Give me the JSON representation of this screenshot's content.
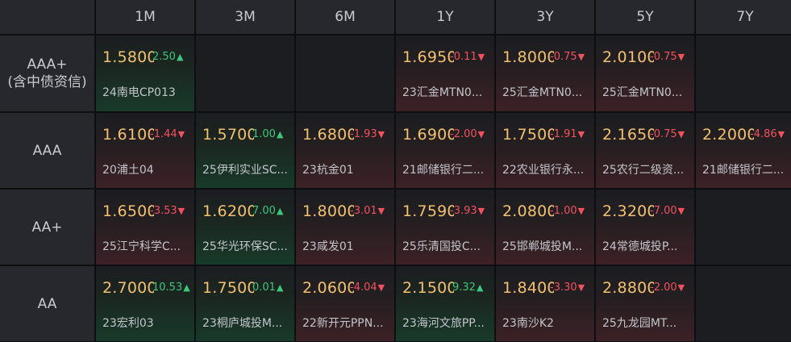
{
  "colors": {
    "up": "#3ec77a",
    "down": "#f2525e",
    "value": "#f2c170"
  },
  "icons": {
    "up": "triangle-up-icon",
    "down": "triangle-down-icon"
  },
  "header": {
    "tenors": [
      "1M",
      "3M",
      "6M",
      "1Y",
      "3Y",
      "5Y",
      "7Y"
    ]
  },
  "rows": [
    {
      "label_lines": [
        "AAA+",
        "(含中债资信)"
      ],
      "cells": [
        {
          "value": "1.5800",
          "change": "2.50",
          "dir": "up",
          "name": "24南电CP013"
        },
        null,
        null,
        {
          "value": "1.6950",
          "change": "-0.11",
          "dir": "down",
          "name": "23汇金MTN0..."
        },
        {
          "value": "1.8000",
          "change": "-0.75",
          "dir": "down",
          "name": "25汇金MTN0..."
        },
        {
          "value": "2.0100",
          "change": "-0.75",
          "dir": "down",
          "name": "25汇金MTN0..."
        },
        null
      ]
    },
    {
      "label_lines": [
        "AAA"
      ],
      "cells": [
        {
          "value": "1.6100",
          "change": "-1.44",
          "dir": "down",
          "name": "20浦土04"
        },
        {
          "value": "1.5700",
          "change": "1.00",
          "dir": "up",
          "name": "25伊利实业SC..."
        },
        {
          "value": "1.6800",
          "change": "-1.93",
          "dir": "down",
          "name": "23杭金01"
        },
        {
          "value": "1.6900",
          "change": "-2.00",
          "dir": "down",
          "name": "21邮储银行二..."
        },
        {
          "value": "1.7500",
          "change": "-1.91",
          "dir": "down",
          "name": "22农业银行永..."
        },
        {
          "value": "2.1650",
          "change": "-0.75",
          "dir": "down",
          "name": "25农行二级资..."
        },
        {
          "value": "2.2000",
          "change": "-4.86",
          "dir": "down",
          "name": "21邮储银行二..."
        }
      ]
    },
    {
      "label_lines": [
        "AA+"
      ],
      "cells": [
        {
          "value": "1.6500",
          "change": "-3.53",
          "dir": "down",
          "name": "25江宁科学C..."
        },
        {
          "value": "1.6200",
          "change": "7.00",
          "dir": "up",
          "name": "25华光环保SC..."
        },
        {
          "value": "1.8000",
          "change": "-3.01",
          "dir": "down",
          "name": "23咸发01"
        },
        {
          "value": "1.7590",
          "change": "-3.93",
          "dir": "down",
          "name": "25乐清国投C..."
        },
        {
          "value": "2.0800",
          "change": "-1.00",
          "dir": "down",
          "name": "25邯郸城投M..."
        },
        {
          "value": "2.3200",
          "change": "-7.00",
          "dir": "down",
          "name": "24常德城投P..."
        },
        null
      ]
    },
    {
      "label_lines": [
        "AA"
      ],
      "cells": [
        {
          "value": "2.7000",
          "change": "10.53",
          "dir": "up",
          "name": "23宏利03"
        },
        {
          "value": "1.7500",
          "change": "0.01",
          "dir": "up",
          "name": "23桐庐城投M..."
        },
        {
          "value": "2.0600",
          "change": "-4.04",
          "dir": "down",
          "name": "22新开元PPN..."
        },
        {
          "value": "2.1500",
          "change": "9.32",
          "dir": "up",
          "name": "23海河文旅PP..."
        },
        {
          "value": "1.8400",
          "change": "-3.30",
          "dir": "down",
          "name": "23南沙K2"
        },
        {
          "value": "2.8800",
          "change": "-2.00",
          "dir": "down",
          "name": "25九龙园MT..."
        },
        null
      ]
    }
  ]
}
